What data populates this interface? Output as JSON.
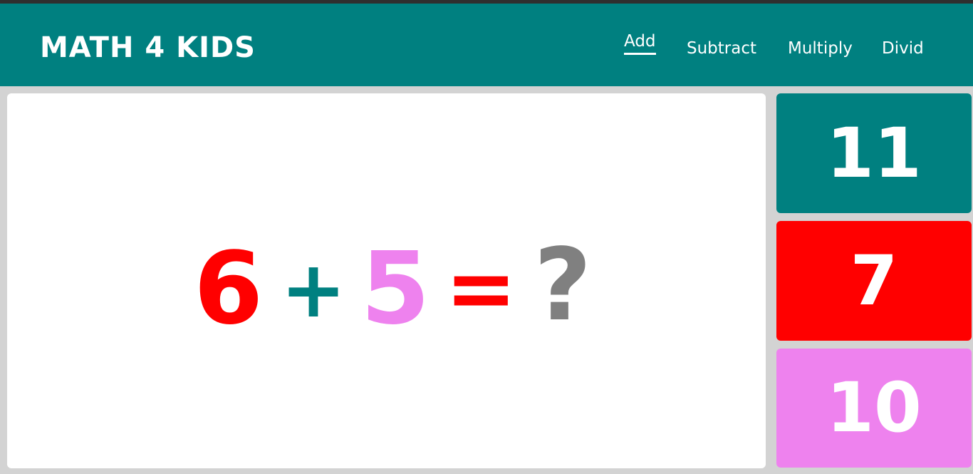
{
  "app": {
    "title": "MATH 4 KIDS"
  },
  "nav": {
    "items": [
      {
        "label": "Add",
        "active": true
      },
      {
        "label": "Subtract",
        "active": false
      },
      {
        "label": "Multiply",
        "active": false
      },
      {
        "label": "Divid",
        "active": false
      }
    ]
  },
  "equation": {
    "operand_a": "6",
    "operator": "+",
    "operand_b": "5",
    "equals": "=",
    "unknown": "?"
  },
  "answers": [
    {
      "value": "11",
      "color": "#008080"
    },
    {
      "value": "7",
      "color": "#ff0000"
    },
    {
      "value": "10",
      "color": "#ee82ee"
    }
  ],
  "colors": {
    "header_bg": "#008080",
    "page_bg": "#d3d3d3",
    "operand_a": "#ff0000",
    "operator": "#008080",
    "operand_b": "#ee82ee",
    "equals": "#ff0000",
    "unknown": "#808080"
  }
}
